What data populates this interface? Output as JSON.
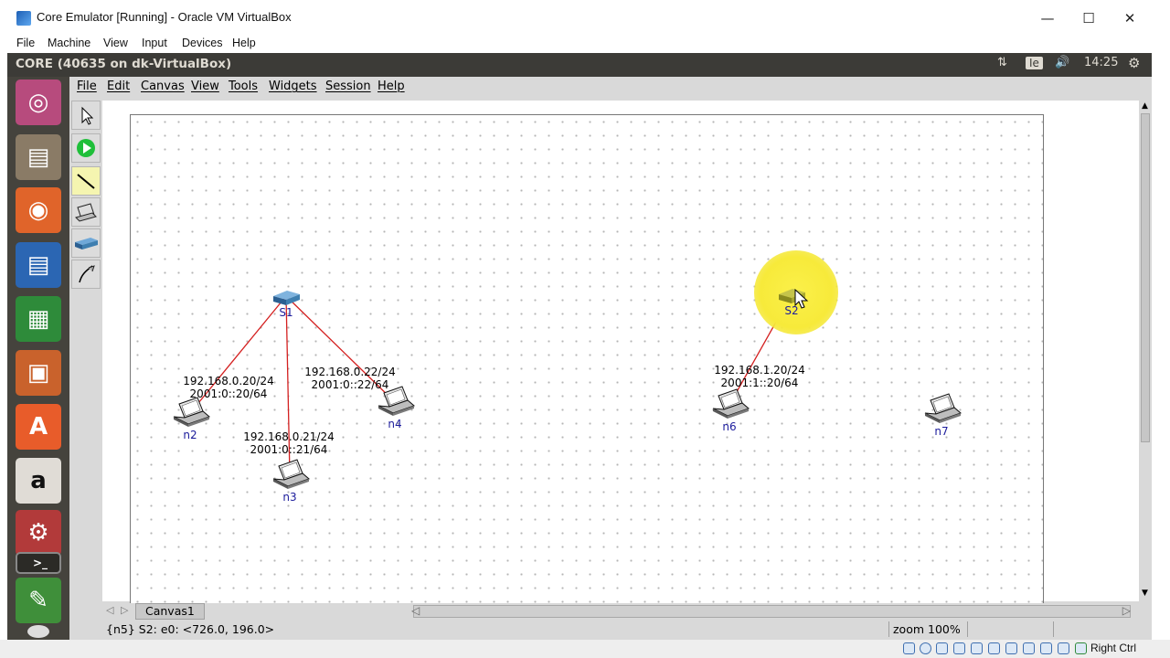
{
  "host_window": {
    "title": "Core Emulator [Running] - Oracle VM VirtualBox",
    "controls": {
      "minimize": "—",
      "maximize": "☐",
      "close": "✕"
    }
  },
  "vbox_menu": [
    "File",
    "Machine",
    "View",
    "Input",
    "Devices",
    "Help"
  ],
  "ubuntu_panel": {
    "window_title": "CORE (40635 on dk-VirtualBox)",
    "keyboard": "Ie",
    "time": "14:25"
  },
  "launcher": [
    {
      "name": "ubuntu-dash",
      "color": "#b74b7d"
    },
    {
      "name": "files",
      "color": "#8a7b66"
    },
    {
      "name": "firefox",
      "color": "#e0642a"
    },
    {
      "name": "writer",
      "color": "#2b66b3"
    },
    {
      "name": "calc",
      "color": "#2e8b3a"
    },
    {
      "name": "impress",
      "color": "#c9622c"
    },
    {
      "name": "software-center",
      "color": "#e85c2a"
    },
    {
      "name": "amazon",
      "color": "#e0dcd6"
    },
    {
      "name": "system-settings",
      "color": "#b23a3a"
    },
    {
      "name": "terminal",
      "color": "#3b3a35"
    },
    {
      "name": "core",
      "color": "#3f8f3a"
    }
  ],
  "core_menu": [
    "File",
    "Edit",
    "Canvas",
    "View",
    "Tools",
    "Widgets",
    "Session",
    "Help"
  ],
  "nodes": [
    {
      "id": "S1",
      "label": "S1",
      "type": "switch"
    },
    {
      "id": "S2",
      "label": "S2",
      "type": "switch"
    },
    {
      "id": "n2",
      "label": "n2",
      "type": "host"
    },
    {
      "id": "n3",
      "label": "n3",
      "type": "host"
    },
    {
      "id": "n4",
      "label": "n4",
      "type": "host"
    },
    {
      "id": "n6",
      "label": "n6",
      "type": "host"
    },
    {
      "id": "n7",
      "label": "n7",
      "type": "host"
    }
  ],
  "links": [
    {
      "from": "S1",
      "to": "n2"
    },
    {
      "from": "S1",
      "to": "n3"
    },
    {
      "from": "S1",
      "to": "n4"
    },
    {
      "from": "S2",
      "to": "n6"
    }
  ],
  "addresses": {
    "n2": {
      "ipv4": "192.168.0.20/24",
      "ipv6": "2001:0::20/64"
    },
    "n3": {
      "ipv4": "192.168.0.21/24",
      "ipv6": "2001:0::21/64"
    },
    "n4": {
      "ipv4": "192.168.0.22/24",
      "ipv6": "2001:0::22/64"
    },
    "n6": {
      "ipv4": "192.168.1.20/24",
      "ipv6": "2001:1::20/64"
    }
  },
  "colors": {
    "link": "#d42020",
    "switch": "#3f7fb0",
    "highlight": "#f7ee3a"
  },
  "canvas_tab": "Canvas1",
  "status": {
    "message": "{n5} S2: e0: <726.0, 196.0>",
    "zoom": "zoom 100%"
  },
  "vbox_status": {
    "host_key": "Right Ctrl"
  }
}
